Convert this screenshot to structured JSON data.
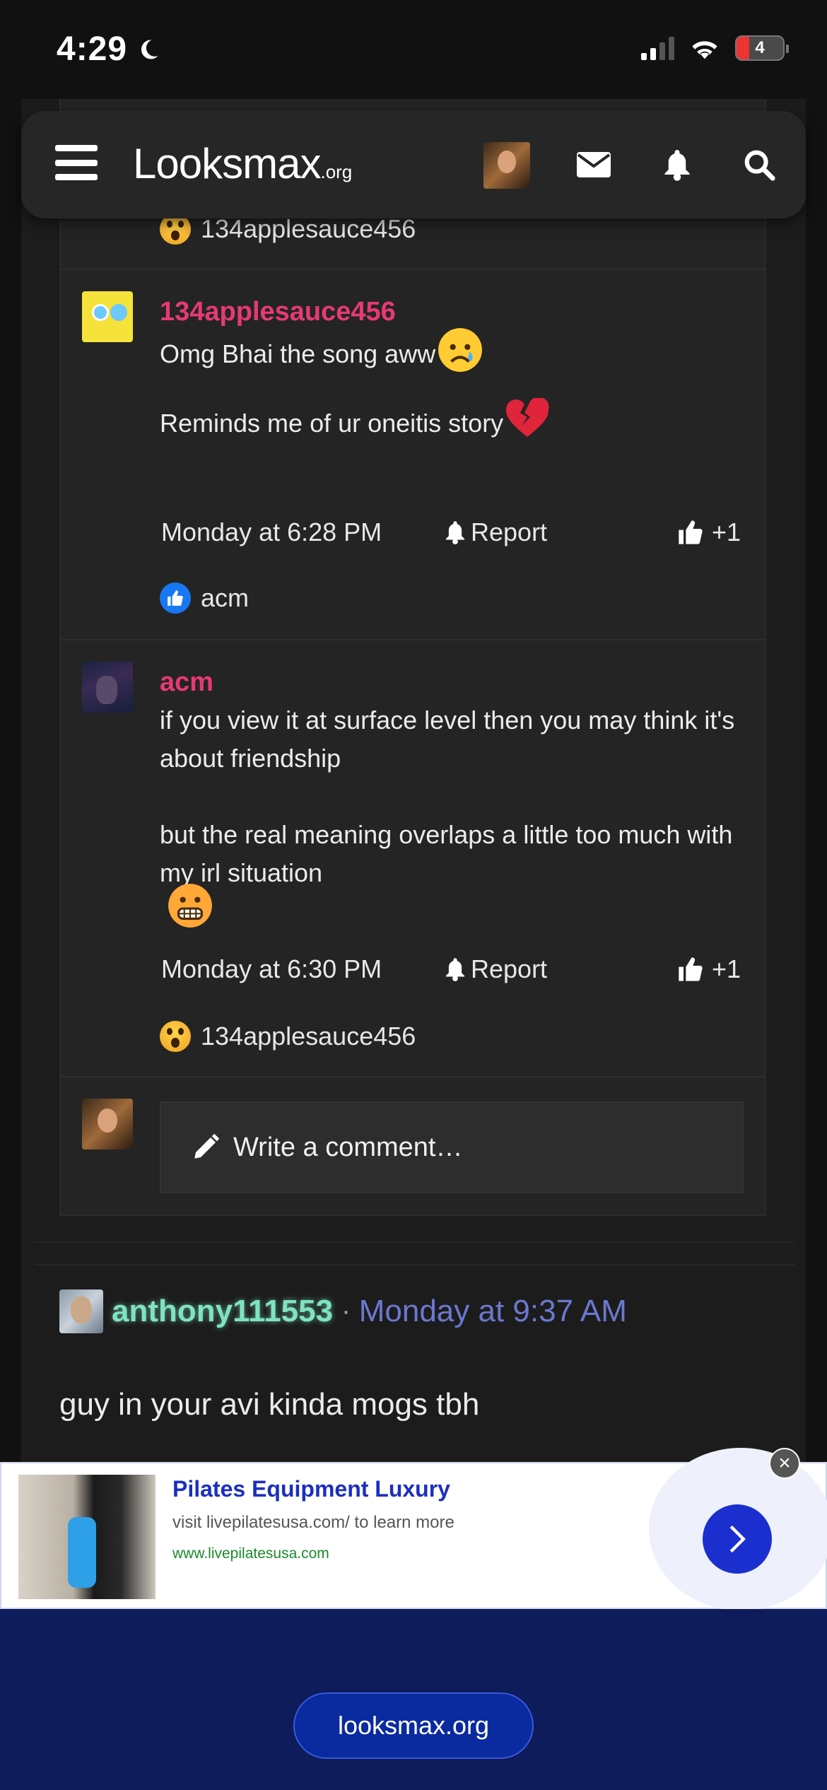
{
  "status_bar": {
    "time": "4:29",
    "battery": "4"
  },
  "nav": {
    "logo_main": "Looksmax",
    "logo_suffix": ".org"
  },
  "reaction_top": {
    "user": "134applesauce456"
  },
  "comments": [
    {
      "username": "134applesauce456",
      "lines": [
        "Omg Bhai the song aww",
        "Reminds me of ur oneitis story"
      ],
      "time": "Monday at 6:28 PM",
      "report": "Report",
      "likes": "+1",
      "reacted_by": "acm"
    },
    {
      "username": "acm",
      "lines": [
        "if you view it at surface level then you may think it's about friendship",
        "but the real meaning overlaps a little too much with my irl situation"
      ],
      "time": "Monday at 6:30 PM",
      "report": "Report",
      "likes": "+1",
      "reacted_by": "134applesauce456"
    }
  ],
  "comment_box": {
    "placeholder": "Write a comment…"
  },
  "post": {
    "username": "anthony111553",
    "separator": "·",
    "date": "Monday at 9:37 AM",
    "body": "guy in your avi kinda mogs tbh"
  },
  "ad": {
    "title": "Pilates Equipment Luxury",
    "description": "visit livepilatesusa.com/ to learn more",
    "url": "www.livepilatesusa.com"
  },
  "footer": {
    "domain": "looksmax.org"
  }
}
